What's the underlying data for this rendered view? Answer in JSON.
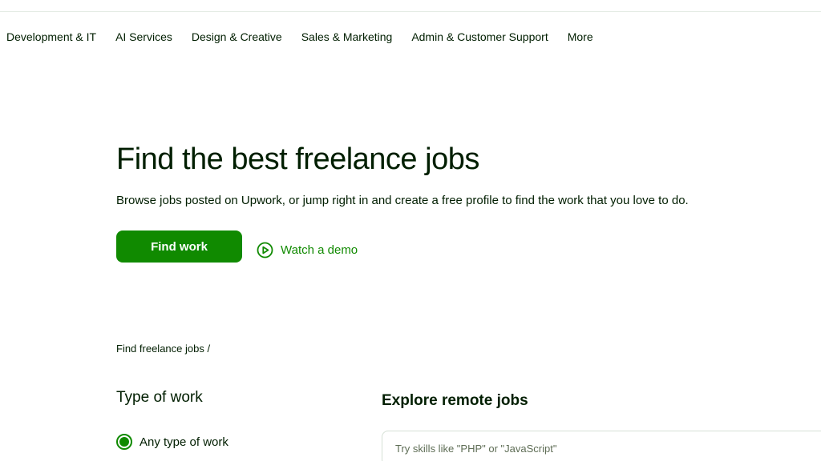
{
  "nav": {
    "items": [
      {
        "label": "Development & IT"
      },
      {
        "label": "AI Services"
      },
      {
        "label": "Design & Creative"
      },
      {
        "label": "Sales & Marketing"
      },
      {
        "label": "Admin & Customer Support"
      },
      {
        "label": "More"
      }
    ]
  },
  "hero": {
    "title": "Find the best freelance jobs",
    "subtitle": "Browse jobs posted on Upwork, or jump right in and create a free profile to find the work that you love to do.",
    "find_work_label": "Find work",
    "watch_demo_label": "Watch a demo",
    "watch_demo_icon": "play-circle-icon"
  },
  "breadcrumb": {
    "label": "Find freelance jobs /"
  },
  "filters": {
    "type_of_work_heading": "Type of work",
    "selected_option": "Any type of work"
  },
  "explore": {
    "heading": "Explore remote jobs",
    "search_placeholder": "Try skills like \"PHP\" or \"JavaScript\"",
    "search_value": ""
  },
  "colors": {
    "brand_green": "#108a00",
    "text_dark": "#001e00",
    "border": "#d5e0d5"
  }
}
